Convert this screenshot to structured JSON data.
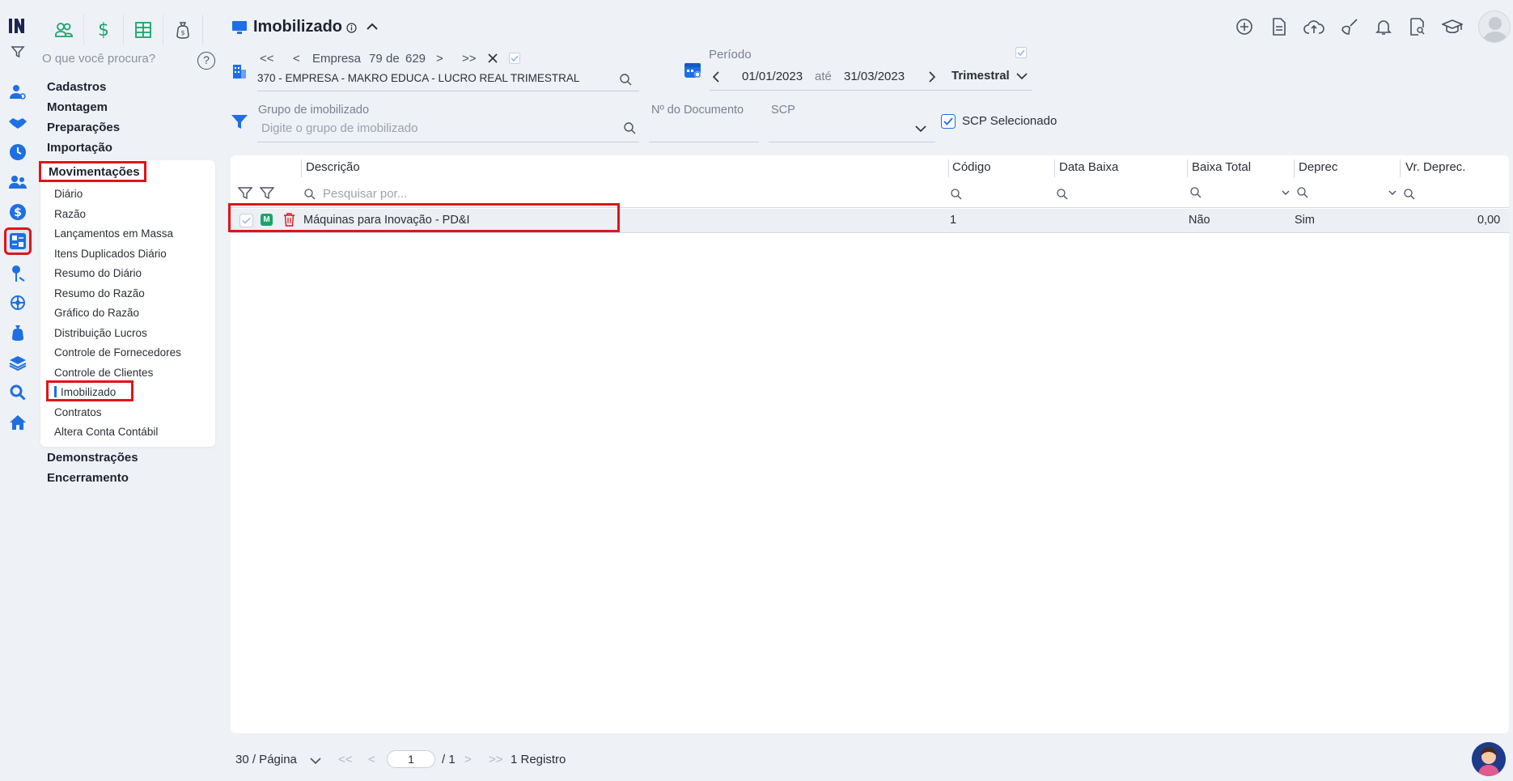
{
  "menu": {
    "search_placeholder": "O que você procura?",
    "help": "?",
    "groups_top": [
      "Cadastros",
      "Montagem",
      "Preparações",
      "Importação"
    ],
    "active_group": "Movimentações",
    "submenu": [
      "Diário",
      "Razão",
      "Lançamentos em Massa",
      "Itens Duplicados Diário",
      "Resumo do Diário",
      "Resumo do Razão",
      "Gráfico do Razão",
      "Distribuição Lucros",
      "Controle de Fornecedores",
      "Controle de Clientes",
      "Imobilizado",
      "Contratos",
      "Altera Conta Contábil"
    ],
    "groups_bottom": [
      "Demonstrações",
      "Encerramento"
    ]
  },
  "page": {
    "title": "Imobilizado"
  },
  "empresa": {
    "label": "Empresa",
    "current": "79",
    "de": "de",
    "total": "629",
    "name": "370 - EMPRESA - MAKRO EDUCA - LUCRO REAL TRIMESTRAL"
  },
  "periodo": {
    "label": "Período",
    "start": "01/01/2023",
    "ate": "até",
    "end": "31/03/2023",
    "type": "Trimestral"
  },
  "filters": {
    "grupo_label": "Grupo de imobilizado",
    "grupo_placeholder": "Digite o grupo de imobilizado",
    "documento_label": "Nº do Documento",
    "scp_label": "SCP",
    "scp_selecionado": "SCP Selecionado"
  },
  "table": {
    "columns": [
      "Descrição",
      "Código",
      "Data Baixa",
      "Baixa Total",
      "Deprec",
      "Vr. Deprec."
    ],
    "search_placeholder": "Pesquisar por...",
    "rows": [
      {
        "badge": "M",
        "descricao": "Máquinas para Inovação - PD&I",
        "codigo": "1",
        "data_baixa": "",
        "baixa_total": "Não",
        "deprec": "Sim",
        "vr_deprec": "0,00"
      }
    ]
  },
  "pager": {
    "page_size": "30 / Página",
    "page": "1",
    "of": "/ 1",
    "records": "1 Registro"
  },
  "colors": {
    "accent": "#1e6fe3",
    "green": "#17a56a",
    "highlight": "#e0141b",
    "delete": "#e0141b"
  }
}
